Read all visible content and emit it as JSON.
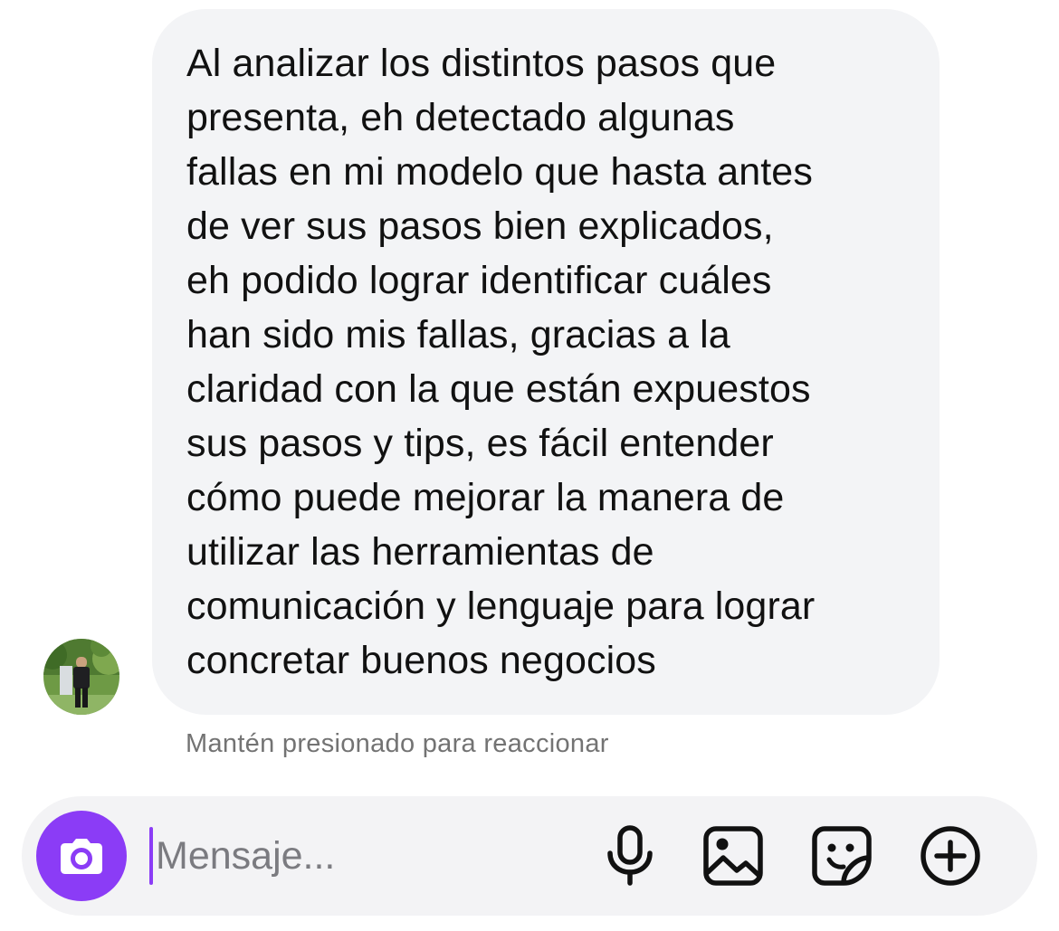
{
  "thread": {
    "message": {
      "text": "Al analizar los distintos pasos que\npresenta, eh detectado algunas\nfallas en mi modelo que hasta antes\nde ver sus pasos bien explicados,\neh podido lograr identificar cuáles\nhan sido mis fallas, gracias a la\nclaridad con la que están expuestos\nsus pasos y tips, es fácil entender\ncómo puede mejorar la manera de\nutilizar las herramientas de\ncomunicación y lenguaje para lograr\nconcretar buenos negocios"
    },
    "hint": "Mantén presionado para reaccionar"
  },
  "composer": {
    "placeholder": "Mensaje...",
    "value": "",
    "icons": [
      "camera-icon",
      "microphone-icon",
      "gallery-icon",
      "sticker-icon",
      "plus-icon"
    ]
  },
  "colors": {
    "accent": "#8b3cf6",
    "bubble_background": "#f3f4f6",
    "hint_text": "#737373",
    "composer_background": "#f3f3f5"
  }
}
